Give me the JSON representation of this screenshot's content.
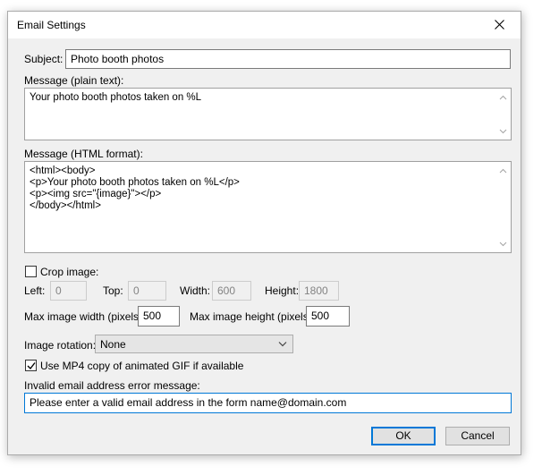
{
  "window": {
    "title": "Email Settings"
  },
  "subject": {
    "label": "Subject:",
    "value": "Photo booth photos"
  },
  "message_plain": {
    "label": "Message (plain text):",
    "value": "Your photo booth photos taken on %L"
  },
  "message_html": {
    "label": "Message (HTML format):",
    "value": "<html><body>\n<p>Your photo booth photos taken on %L</p>\n<p><img src=\"{image}\"></p>\n</body></html>"
  },
  "crop": {
    "label": "Crop image:",
    "checked": false,
    "left_label": "Left:",
    "left_value": "0",
    "top_label": "Top:",
    "top_value": "0",
    "width_label": "Width:",
    "width_value": "600",
    "height_label": "Height:",
    "height_value": "1800"
  },
  "max_width": {
    "label": "Max image width (pixels):",
    "value": "500"
  },
  "max_height": {
    "label": "Max image height (pixels):",
    "value": "500"
  },
  "rotation": {
    "label": "Image rotation:",
    "value": "None"
  },
  "mp4": {
    "label": "Use MP4 copy of animated GIF if available",
    "checked": true
  },
  "invalid_email": {
    "label": "Invalid email address error message:",
    "value": "Please enter a valid email address in the form name@domain.com"
  },
  "buttons": {
    "ok": "OK",
    "cancel": "Cancel"
  },
  "colors": {
    "focus_border": "#0078d7",
    "dialog_bg": "#f0f0f0"
  },
  "icons": {
    "close": "close-icon",
    "scroll_up": "chevron-up-icon",
    "scroll_down": "chevron-down-icon",
    "dropdown": "chevron-down-icon",
    "check": "check-icon"
  }
}
